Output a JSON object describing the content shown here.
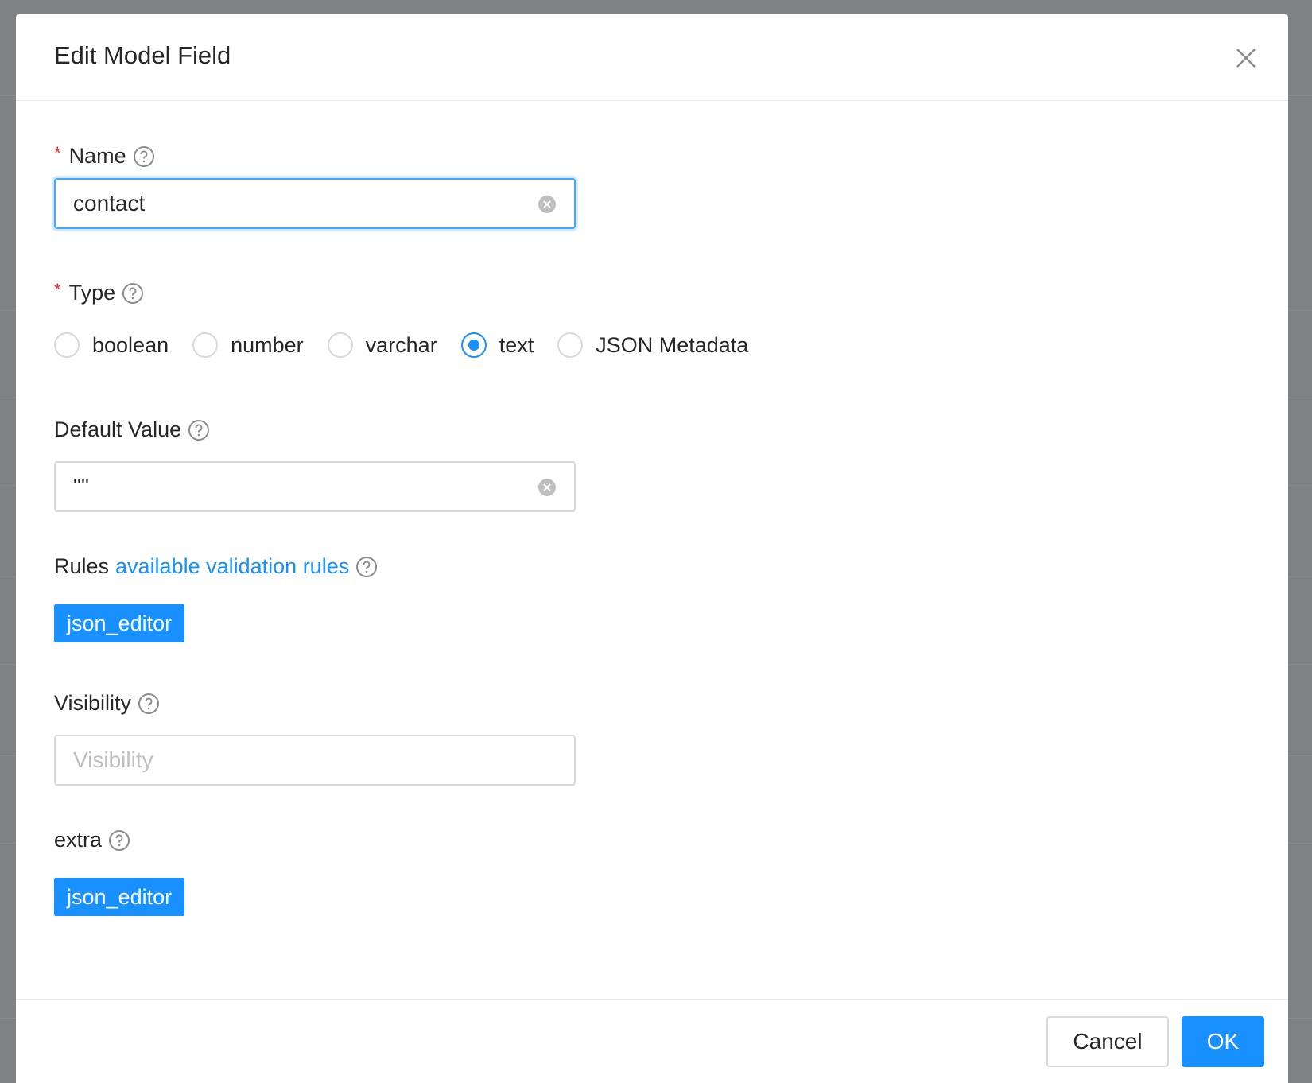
{
  "modal": {
    "title": "Edit Model Field",
    "close_icon": "close-icon"
  },
  "form": {
    "name": {
      "label": "Name",
      "required": true,
      "value": "contact",
      "help_icon": "question-circle-icon"
    },
    "type": {
      "label": "Type",
      "required": true,
      "options": [
        "boolean",
        "number",
        "varchar",
        "text",
        "JSON Metadata"
      ],
      "selected": "text"
    },
    "default_value": {
      "label": "Default Value",
      "value": "\"\""
    },
    "rules": {
      "label": "Rules",
      "link": "available validation rules",
      "button": "json_editor"
    },
    "visibility": {
      "label": "Visibility",
      "placeholder": "Visibility",
      "value": ""
    },
    "extra": {
      "label": "extra",
      "button": "json_editor"
    }
  },
  "footer": {
    "cancel_label": "Cancel",
    "ok_label": "OK"
  },
  "colors": {
    "primary": "#1890ff",
    "required": "#f5222d",
    "mask": "#808182"
  }
}
